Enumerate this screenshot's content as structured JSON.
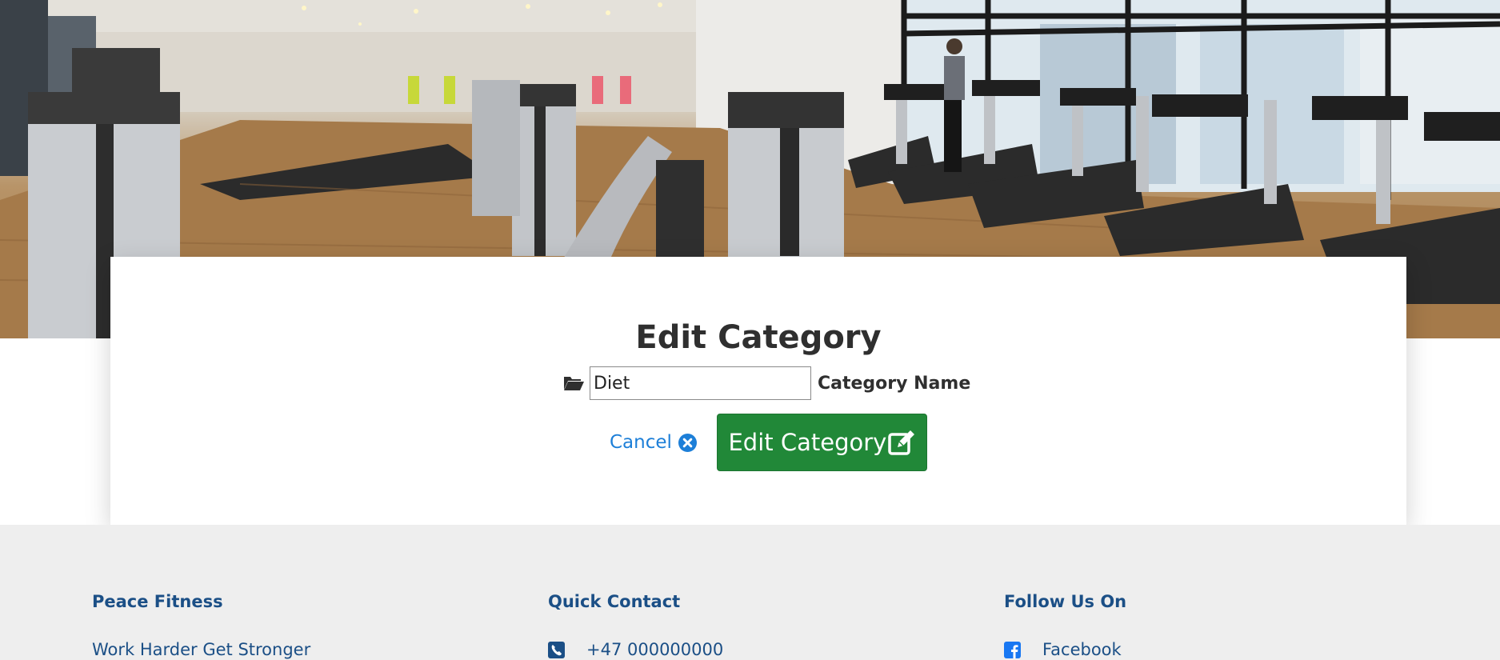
{
  "card": {
    "title": "Edit Category",
    "input_value": "Diet",
    "input_label": "Category Name",
    "cancel_label": "Cancel",
    "submit_label": "Edit Category"
  },
  "footer": {
    "col1": {
      "heading": "Peace Fitness",
      "item": "Work Harder Get Stronger"
    },
    "col2": {
      "heading": "Quick Contact",
      "item": "+47 000000000",
      "icon": "phone-icon"
    },
    "col3": {
      "heading": "Follow Us On",
      "item": "Facebook",
      "icon": "facebook-icon"
    }
  },
  "colors": {
    "primary_button": "#218838",
    "link": "#1d7fd8",
    "footer_text": "#1b4f86",
    "footer_bg": "#eeeeee"
  }
}
